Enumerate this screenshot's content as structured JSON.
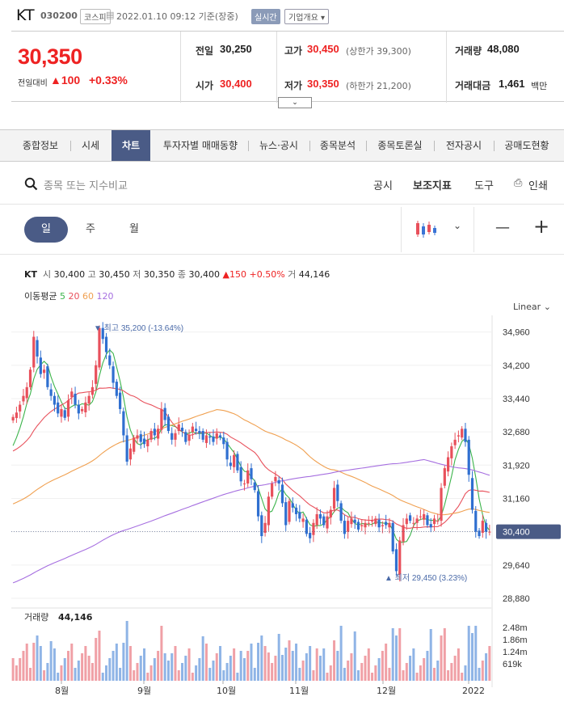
{
  "header": {
    "name": "KT",
    "code": "030200",
    "market": "코스피",
    "datetime": "2022.01.10 09:12 기준(장중)",
    "live_label": "실시간",
    "corp_label": "기업개요"
  },
  "price": {
    "current": "30,350",
    "change_label": "전일대비",
    "change": "100",
    "change_pct": "+0.33%",
    "prev_label": "전일",
    "prev": "30,250",
    "high_label": "고가",
    "high": "30,450",
    "upper_limit": "(상한가 39,300)",
    "volume_label": "거래량",
    "volume": "48,080",
    "open_label": "시가",
    "open": "30,400",
    "low_label": "저가",
    "low": "30,350",
    "lower_limit": "(하한가 21,200)",
    "amount_label": "거래대금",
    "amount": "1,461",
    "amount_unit": "백만"
  },
  "tabs": [
    "종합정보",
    "시세",
    "차트",
    "투자자별 매매동향",
    "뉴스·공시",
    "종목분석",
    "종목토론실",
    "전자공시",
    "공매도현황"
  ],
  "toolbar": {
    "search_placeholder": "종목 또는 지수비교",
    "disclosure": "공시",
    "indicators": "보조지표",
    "tools": "도구",
    "print": "인쇄",
    "periods": [
      "일",
      "주",
      "월"
    ],
    "minus": "—",
    "plus": "+",
    "chevron": "⌄"
  },
  "chart_info": {
    "name": "KT",
    "open_label": "시",
    "open": "30,400",
    "high_label": "고",
    "high": "30,450",
    "low_label": "저",
    "low": "30,350",
    "close_label": "종",
    "close": "30,400",
    "change": "▲150",
    "change_pct": "+0.50%",
    "vol_label": "거",
    "volume": "44,146",
    "ma_label": "이동평균",
    "ma": [
      {
        "p": "5",
        "color": "#3cb44b"
      },
      {
        "p": "20",
        "color": "#e8505b"
      },
      {
        "p": "60",
        "color": "#f0a050"
      },
      {
        "p": "120",
        "color": "#a66fe0"
      }
    ],
    "scale": "Linear",
    "max_label": "▼ 최고 35,200 (-13.64%)",
    "min_label": "▲ 최저 29,450 (3.23%)",
    "current_tag": "30,400",
    "volume_title": "거래량",
    "volume_value": "44,146"
  },
  "chart_data": {
    "type": "candlestick",
    "y_ticks": [
      "34,960",
      "34,200",
      "33,440",
      "32,680",
      "31,920",
      "31,160",
      "30,400",
      "29,640",
      "28,880"
    ],
    "ylim": [
      28880,
      35340
    ],
    "x_labels": [
      "8월",
      "9월",
      "10월",
      "11월",
      "12월",
      "2022"
    ],
    "vol_ticks": [
      "2.48m",
      "1.86m",
      "1.24m",
      "619k"
    ],
    "vol_max": 2480000,
    "closes": [
      33020,
      33120,
      33300,
      33500,
      33700,
      34100,
      34850,
      34400,
      34000,
      34100,
      33700,
      33500,
      33300,
      33100,
      33200,
      33000,
      33400,
      33600,
      33300,
      33100,
      33200,
      33350,
      33500,
      33700,
      34200,
      35050,
      34800,
      34500,
      34200,
      33800,
      33500,
      33200,
      32600,
      32000,
      32300,
      32550,
      32600,
      32450,
      32400,
      32500,
      32700,
      32600,
      32750,
      33200,
      32950,
      32700,
      32500,
      32650,
      32850,
      32700,
      32450,
      32600,
      32800,
      32700,
      32650,
      32500,
      32600,
      32550,
      32450,
      32650,
      32550,
      32400,
      32050,
      31900,
      32150,
      31800,
      31550,
      31500,
      31800,
      31600,
      31350,
      30750,
      30300,
      30600,
      31200,
      31500,
      31650,
      31500,
      31050,
      30550,
      31100,
      30950,
      30800,
      30700,
      30700,
      30350,
      30250,
      30600,
      30800,
      30700,
      30550,
      30750,
      30900,
      31400,
      31100,
      30650,
      30350,
      30650,
      30700,
      30600,
      30450,
      30550,
      30600,
      30600,
      30650,
      30700,
      30500,
      30550,
      30550,
      30600,
      29950,
      29500,
      30200,
      30550,
      30700,
      30650,
      30600,
      30700,
      30750,
      30800,
      30550,
      30500,
      30700,
      30650,
      31400,
      31850,
      32100,
      32350,
      32500,
      32600,
      32750,
      32450,
      31700,
      30900,
      30400,
      30300,
      30650,
      30400,
      30400
    ]
  }
}
